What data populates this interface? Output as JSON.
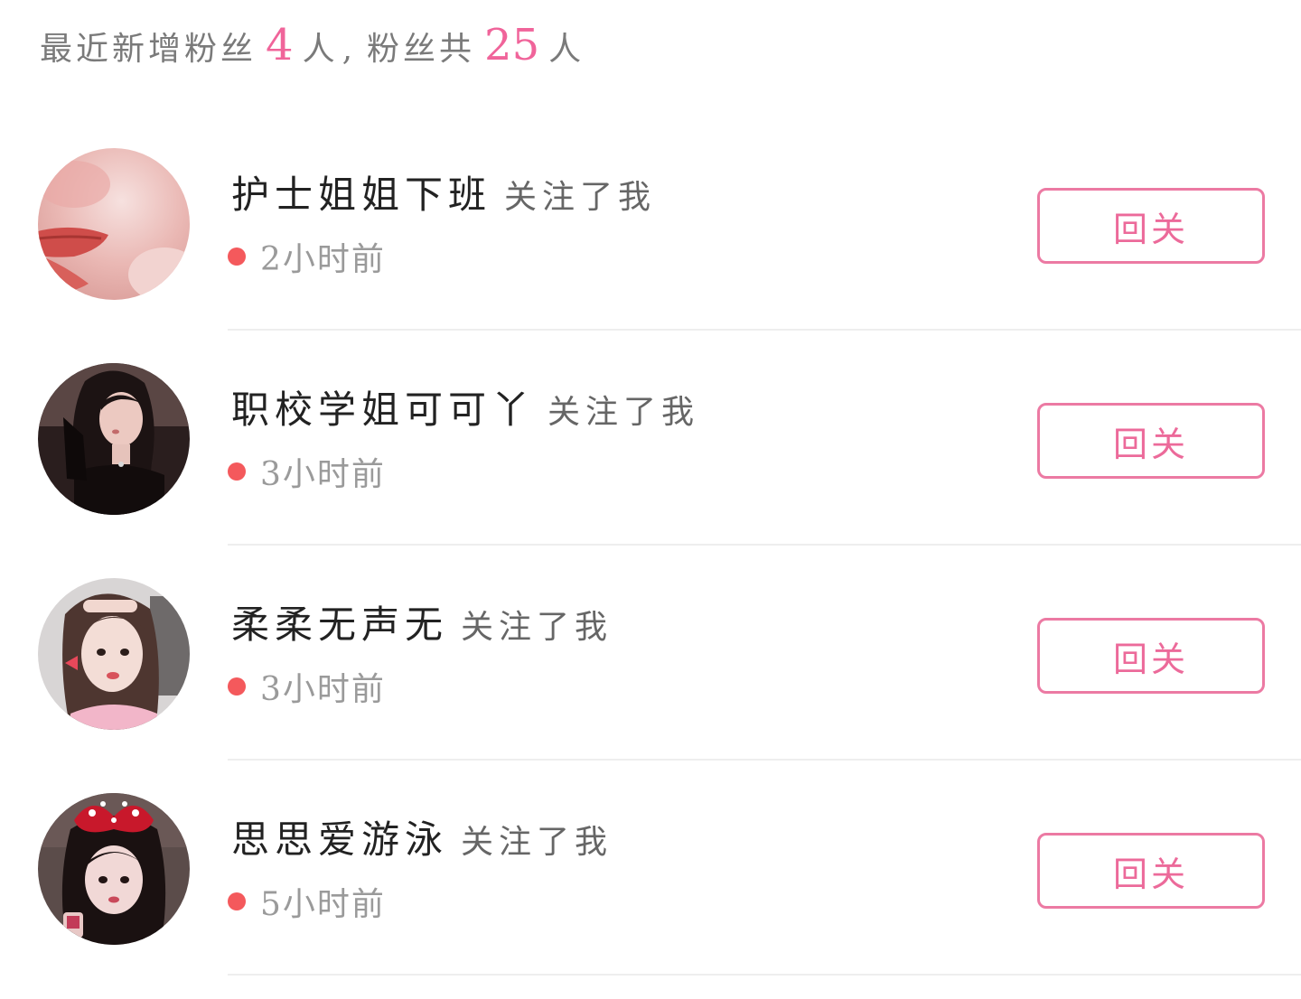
{
  "summary": {
    "prefix": "最近新增粉丝",
    "new_count": "4",
    "unit1": "人",
    "separator": ",",
    "middle": "粉丝共",
    "total_count": "25",
    "unit2": "人"
  },
  "followers": [
    {
      "name": "护士姐姐下班",
      "action": "关注了我",
      "time": "2小时前",
      "button": "回关",
      "avatar_icon": "avatar-lips-photo",
      "avatar_colors": [
        "#f3d2d2",
        "#e7aaa8",
        "#d9534f"
      ]
    },
    {
      "name": "职校学姐可可丫",
      "action": "关注了我",
      "time": "3小时前",
      "button": "回关",
      "avatar_icon": "avatar-girl-dark-photo",
      "avatar_colors": [
        "#3b2b2b",
        "#e9c8c0",
        "#1a1212"
      ]
    },
    {
      "name": "柔柔无声无",
      "action": "关注了我",
      "time": "3小时前",
      "button": "回关",
      "avatar_icon": "avatar-girl-light-photo",
      "avatar_colors": [
        "#d9d6d6",
        "#f1d6cf",
        "#5a3e36"
      ]
    },
    {
      "name": "思思爱游泳",
      "action": "关注了我",
      "time": "5小时前",
      "button": "回关",
      "avatar_icon": "avatar-girl-bow-photo",
      "avatar_colors": [
        "#5a4a48",
        "#f0d5d5",
        "#c8182b"
      ]
    }
  ],
  "colors": {
    "accent_pink": "#f0649a",
    "button_border": "#ec7aa3",
    "dot_red": "#f4595c",
    "divider": "#eeeeee"
  }
}
